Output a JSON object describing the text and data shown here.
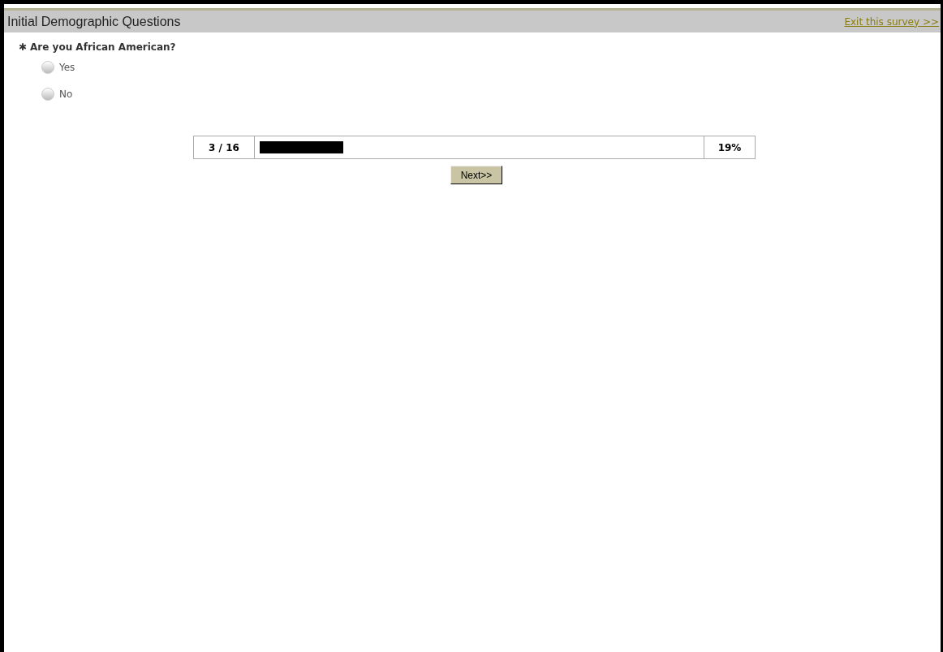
{
  "header": {
    "title": "Initial Demographic Questions",
    "exit_link": "Exit this survey >>"
  },
  "question": {
    "required_mark": "✱",
    "text": "Are you African American?",
    "options": [
      {
        "label": "Yes",
        "selected": false
      },
      {
        "label": "No",
        "selected": false
      }
    ]
  },
  "progress": {
    "position": "3 / 16",
    "level": 0.19,
    "percent": "19%"
  },
  "next_button": "Next>>"
}
